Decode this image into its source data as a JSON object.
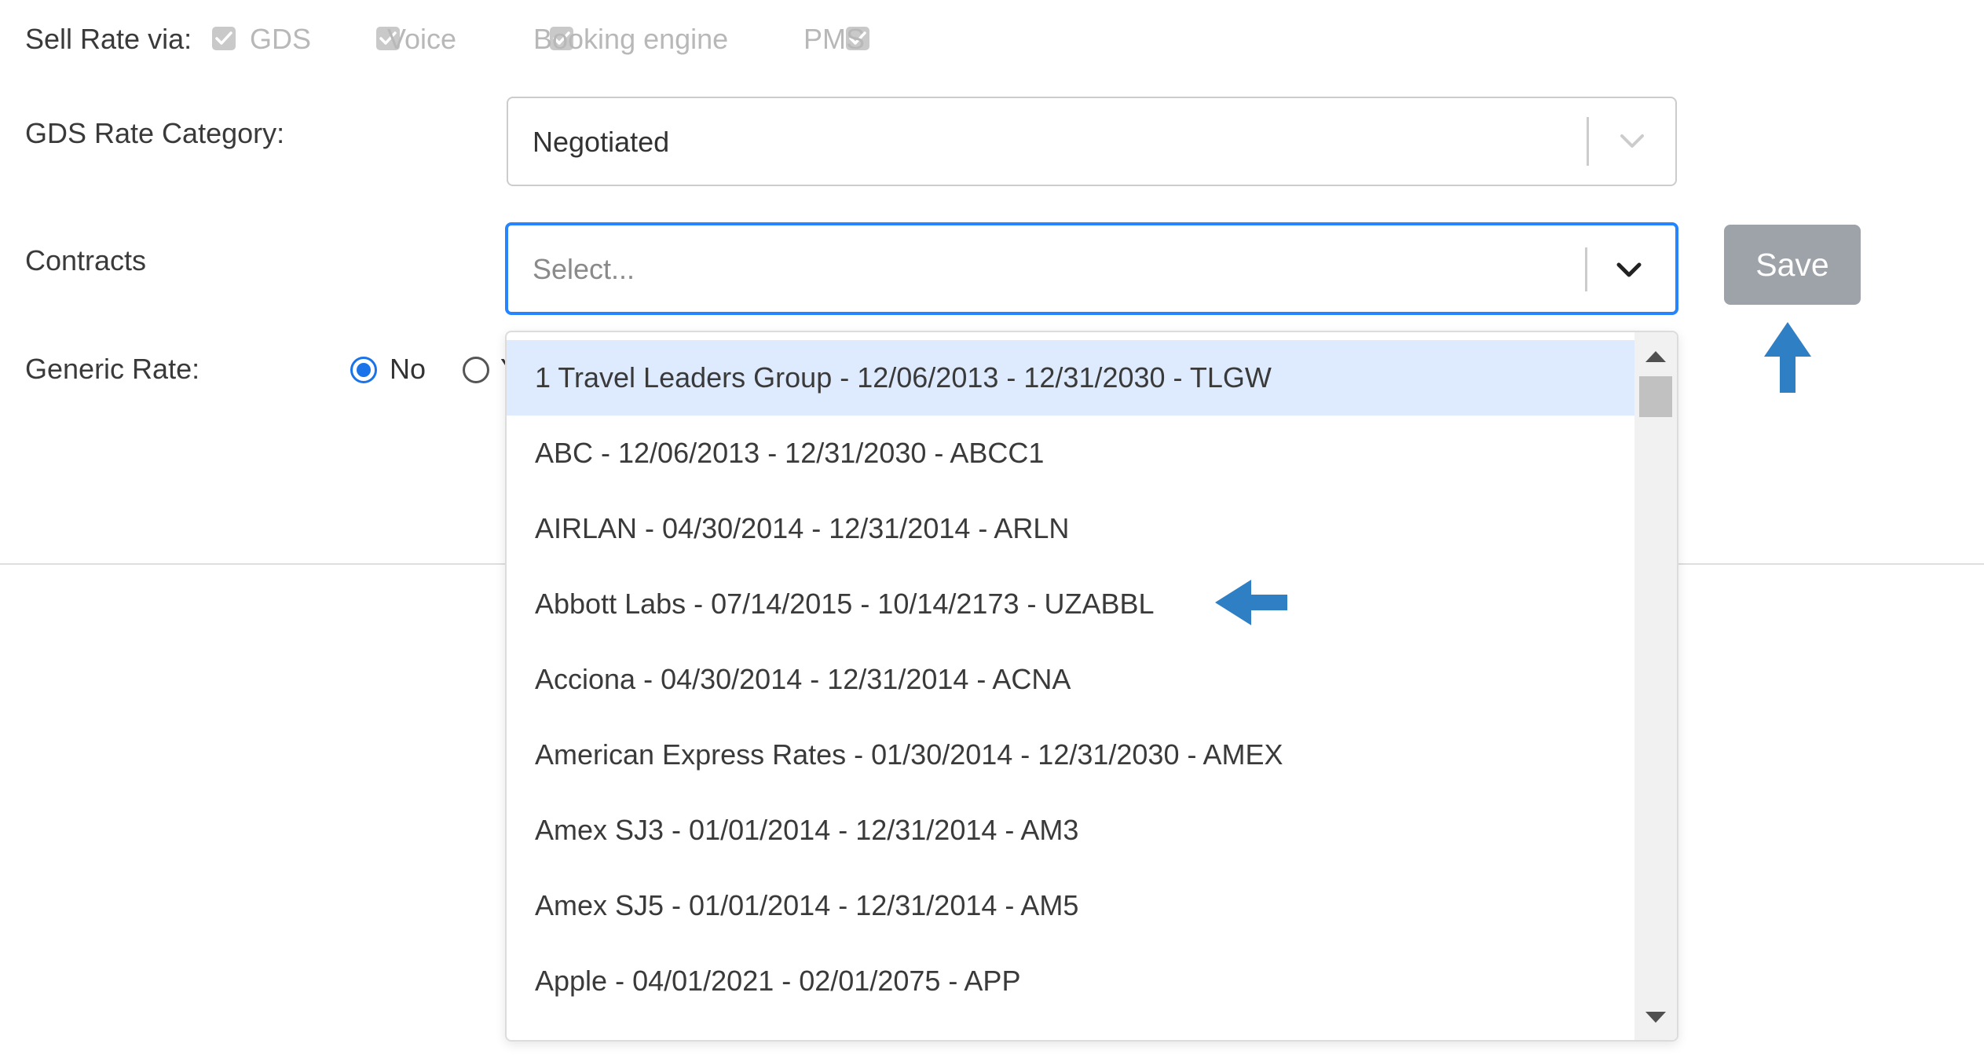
{
  "sell_rate": {
    "label": "Sell Rate via:",
    "channels": [
      {
        "label": "GDS",
        "checked": true,
        "disabled": true
      },
      {
        "label": "Voice",
        "checked": true,
        "disabled": true
      },
      {
        "label": "Booking engine",
        "checked": true,
        "disabled": true
      },
      {
        "label": "PMS",
        "checked": true,
        "disabled": true
      }
    ]
  },
  "gds_rate_category": {
    "label": "GDS Rate Category:",
    "value": "Negotiated"
  },
  "contracts": {
    "label": "Contracts",
    "placeholder": "Select...",
    "options": [
      "1 Travel Leaders Group - 12/06/2013 - 12/31/2030 - TLGW",
      "ABC - 12/06/2013 - 12/31/2030 - ABCC1",
      "AIRLAN - 04/30/2014 - 12/31/2014 - ARLN",
      "Abbott Labs - 07/14/2015 - 10/14/2173 - UZABBL",
      "Acciona - 04/30/2014 - 12/31/2014 - ACNA",
      "American Express Rates - 01/30/2014 - 12/31/2030 - AMEX",
      "Amex SJ3 - 01/01/2014 - 12/31/2014 - AM3",
      "Amex SJ5 - 01/01/2014 - 12/31/2014 - AM5",
      "Apple - 04/01/2021 - 02/01/2075 - APP"
    ],
    "focused_index": 0
  },
  "save_button": {
    "label": "Save"
  },
  "generic_rate": {
    "label": "Generic Rate:",
    "options": [
      {
        "label": "No",
        "selected": true
      },
      {
        "label": "Y",
        "selected": false
      }
    ]
  },
  "colors": {
    "focus_border": "#2684ff",
    "option_focused_bg": "#deebff",
    "radio_selected": "#1a73e8",
    "save_button_bg": "#9ea3a9",
    "annotation_arrow": "#2f7fc5"
  }
}
